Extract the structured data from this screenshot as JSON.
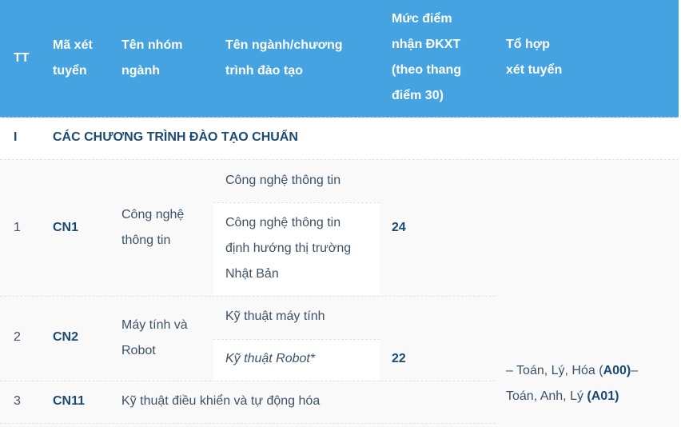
{
  "header": {
    "col_tt": "TT",
    "col_code": [
      "Mã xét",
      "tuyển"
    ],
    "col_group": [
      "Tên nhóm",
      "ngành"
    ],
    "col_program": [
      "Tên ngành/chương",
      "trình đào tạo"
    ],
    "col_score": [
      "Mức điểm",
      "nhận ĐKXT",
      "(theo thang",
      "điểm 30)"
    ],
    "col_combo": [
      "Tổ hợp",
      "xét tuyển"
    ]
  },
  "section": {
    "index": "I",
    "title": "CÁC CHƯƠNG TRÌNH ĐÀO TẠO CHUẨN"
  },
  "rows": [
    {
      "tt": "1",
      "code": "CN1",
      "group": [
        "Công nghệ",
        "thông tin"
      ],
      "programs": [
        {
          "lines": [
            "Công nghệ thông tin"
          ]
        },
        {
          "lines": [
            "Công nghệ thông tin",
            "định hướng thị trường",
            "Nhật Bản"
          ]
        }
      ],
      "score": "24"
    },
    {
      "tt": "2",
      "code": "CN2",
      "group": [
        "Máy tính và",
        "Robot"
      ],
      "programs": [
        {
          "lines": [
            "Kỹ thuật máy tính"
          ]
        },
        {
          "lines": [
            "Kỹ thuật Robot*"
          ]
        }
      ],
      "score": "22"
    },
    {
      "tt": "3",
      "code": "CN11",
      "group_and_program": "Kỹ thuật điều khiển và tự động hóa"
    }
  ],
  "combo": {
    "line1_prefix": "– Toán, Lý, Hóa (",
    "line1_code": "A00)",
    "line1_suffix": "–",
    "line2_prefix": "Toán, Anh, Lý ",
    "line2_code": "(A01)"
  }
}
